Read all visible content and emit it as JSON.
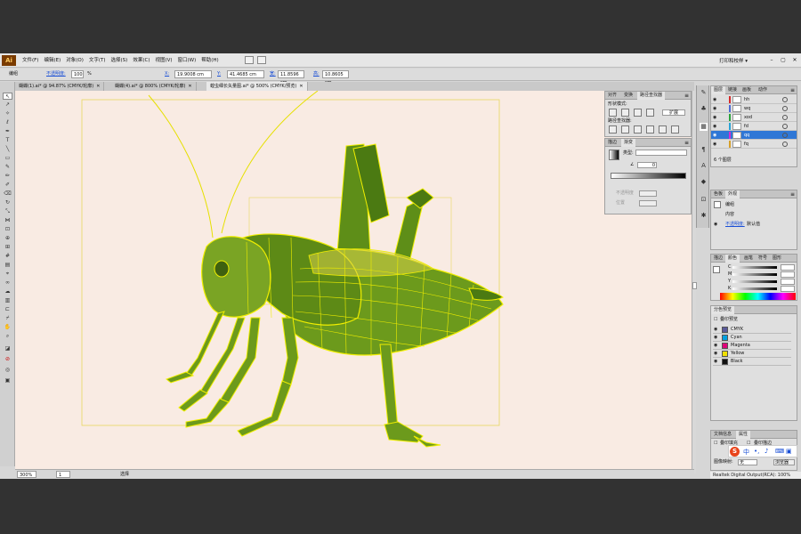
{
  "menubar": {
    "logo": "Ai",
    "items": [
      "文件(F)",
      "编辑(E)",
      "对象(O)",
      "文字(T)",
      "选择(S)",
      "效果(C)",
      "视图(V)",
      "窗口(W)",
      "帮助(H)"
    ],
    "preset": "打印和校样 ▾"
  },
  "control": {
    "mode": "编组",
    "opacity_label": "不透明度:",
    "opacity_value": "100",
    "opacity_unit": "%",
    "x_label": "X:",
    "x_value": "19.9008 cm",
    "y_label": "Y:",
    "y_value": "41.4685 cm",
    "w_label": "宽:",
    "w_value": "11.8596 cm",
    "h_label": "高:",
    "h_value": "10.8605 cm"
  },
  "tabs": [
    {
      "label": "蝴蝶(1).ai* @ 94.87% (CMYK/轮廓)"
    },
    {
      "label": "蝴蝶(4).ai* @ 800% (CMYK/轮廓)"
    },
    {
      "label": "蝗虫细长矢量图.ai* @ 500% (CMYK/预览)",
      "active": true
    }
  ],
  "status": {
    "zoom": "300%",
    "page": "1",
    "tool": "选择"
  },
  "pathfinder": {
    "tabs": [
      "对齐",
      "变换",
      "路径查找器"
    ],
    "shape_modes_label": "形状模式:",
    "expand": "扩展",
    "pathfinders_label": "路径查找器:"
  },
  "gradient": {
    "tabs": [
      "描边",
      "渐变"
    ],
    "type_label": "类型:",
    "angle_value": "0",
    "opacity_label": "不透明度",
    "position_label": "位置"
  },
  "layers": {
    "tabs": [
      "图层",
      "链接",
      "画板",
      "动作"
    ],
    "rows": [
      {
        "name": "hh",
        "color": "#d62a2a"
      },
      {
        "name": "wq",
        "color": "#4a6ad6"
      },
      {
        "name": "xod",
        "color": "#2aa33a"
      },
      {
        "name": "fd",
        "color": "#2aa3d6"
      },
      {
        "name": "qq",
        "color": "#d62ad6",
        "selected": true
      },
      {
        "name": "fq",
        "color": "#d6a02a"
      }
    ],
    "count": "6 个图层"
  },
  "appearance": {
    "tabs": [
      "色板",
      "外观"
    ],
    "group": "编组",
    "contents": "内容",
    "opacity_label": "不透明度:",
    "opacity_value": "默认值"
  },
  "color": {
    "tabs": [
      "描边",
      "颜色",
      "画笔",
      "符号",
      "图形"
    ],
    "channels": [
      "C",
      "M",
      "Y",
      "K"
    ]
  },
  "separations": {
    "title": "分色预览",
    "overprint": "叠印预览",
    "rows": [
      {
        "name": "CMYK",
        "color": "#5a5a9a"
      },
      {
        "name": "Cyan",
        "color": "#00a0e0"
      },
      {
        "name": "Magenta",
        "color": "#e0007a"
      },
      {
        "name": "Yellow",
        "color": "#f0e000"
      },
      {
        "name": "Black",
        "color": "#111111"
      }
    ]
  },
  "docinfo": {
    "tabs": [
      "文档信息",
      "属性"
    ],
    "overprint_fill": "叠印填充",
    "overprint_stroke": "叠印描边",
    "image_map_label": "图像映射:",
    "image_map_value": "无",
    "browser_btn": "浏览器"
  },
  "ime": {
    "badge": "S",
    "text": "中"
  },
  "realtek": "Realtek Digital Output(RCA): 100%",
  "colors": {
    "canvas": "#f9ebe3",
    "selection_yellow": "#f4f000",
    "body_green": "#6c9a1c",
    "selected_layer": "#2f77d6"
  }
}
